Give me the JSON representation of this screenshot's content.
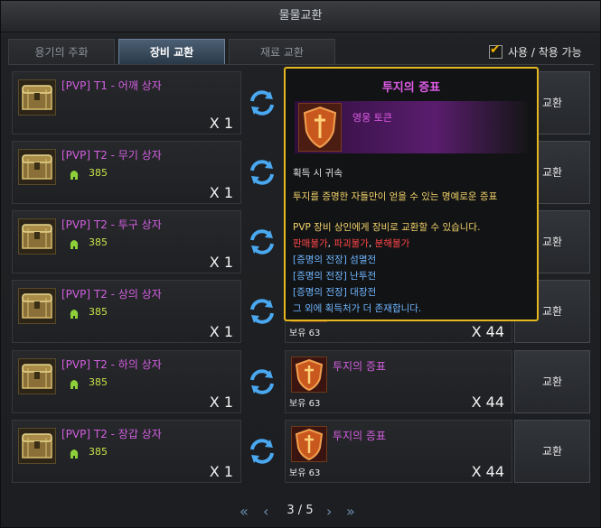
{
  "window": {
    "title": "물물교환"
  },
  "tabs": [
    {
      "label": "용기의 주화",
      "active": false
    },
    {
      "label": "장비 교환",
      "active": true
    },
    {
      "label": "재료 교환",
      "active": false
    }
  ],
  "filter": {
    "label": "사용 / 착용 가능",
    "checked": true
  },
  "rows": [
    {
      "name": "[PVP] T1 - 어깨 상자",
      "cost": "",
      "qty": "X 1",
      "token_name": "",
      "owned": "",
      "token_qty": "",
      "button": "교환"
    },
    {
      "name": "[PVP] T2 - 무기 상자",
      "cost": "385",
      "qty": "X 1",
      "token_name": "",
      "owned": "",
      "token_qty": "",
      "button": "교환"
    },
    {
      "name": "[PVP] T2 - 투구 상자",
      "cost": "385",
      "qty": "X 1",
      "token_name": "",
      "owned": "",
      "token_qty": "",
      "button": "교환"
    },
    {
      "name": "[PVP] T2 - 상의 상자",
      "cost": "385",
      "qty": "X 1",
      "token_name": "",
      "owned": "보유 63",
      "token_qty": "X 44",
      "button": "교환"
    },
    {
      "name": "[PVP] T2 - 하의 상자",
      "cost": "385",
      "qty": "X 1",
      "token_name": "투지의 증표",
      "owned": "보유 63",
      "token_qty": "X 44",
      "button": "교환"
    },
    {
      "name": "[PVP] T2 - 장갑 상자",
      "cost": "385",
      "qty": "X 1",
      "token_name": "투지의 증표",
      "owned": "보유 63",
      "token_qty": "X 44",
      "button": "교환"
    }
  ],
  "tooltip": {
    "title": "투지의 증표",
    "subname": "영웅 토큰",
    "bind": "획득 시 귀속",
    "desc": "투지를 증명한 자들만이 얻을 수 있는 명예로운 증표",
    "usage": "PVP 장비 상인에게 장비로 교환할 수 있습니다.",
    "restrictions": [
      "판매불가",
      "파괴불가",
      "분해불가"
    ],
    "sources": [
      "[증명의 전장] 섬멸전",
      "[증명의 전장] 난투전",
      "[증명의 전장] 대장전"
    ],
    "more": "그 외에 획득처가 더 존재합니다."
  },
  "pager": {
    "current": "3",
    "total": "5",
    "label": "3 / 5"
  },
  "colors": {
    "item_name": "#d35fe0",
    "cost": "#c9e34a",
    "tooltip_border": "#e6b71e",
    "restriction": "#ff4646",
    "source": "#6fb6ff",
    "description": "#f2d36a"
  }
}
